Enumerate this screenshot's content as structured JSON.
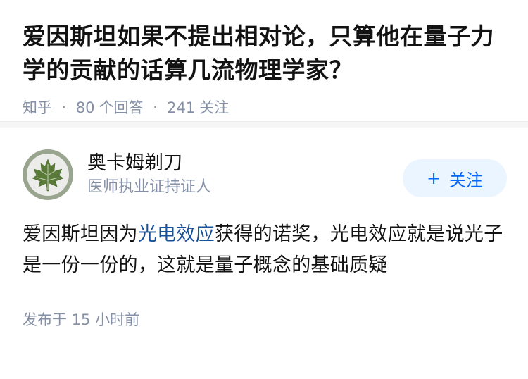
{
  "question": {
    "title": "爱因斯坦如果不提出相对论，只算他在量子力学的贡献的话算几流物理学家？",
    "source": "知乎",
    "answers_count": "80",
    "answers_label": "个回答",
    "followers_count": "241",
    "followers_label": "关注"
  },
  "answer": {
    "author_name": "奥卡姆剃刀",
    "author_title": "医师执业证持证人",
    "follow_label": "关注",
    "content_before": "爱因斯坦因为",
    "content_link": "光电效应",
    "content_after": "获得的诺奖，光电效应就是说光子是一份一份的，这就是量子概念的基础质疑",
    "time_label": "发布于",
    "time_value": "15 小时前"
  },
  "colors": {
    "primary": "#0066ff",
    "link": "#175199",
    "meta": "#8590a6",
    "follow_bg": "#ebf5ff"
  },
  "icons": {
    "avatar": "maple-leaf-icon",
    "follow": "plus-icon"
  }
}
